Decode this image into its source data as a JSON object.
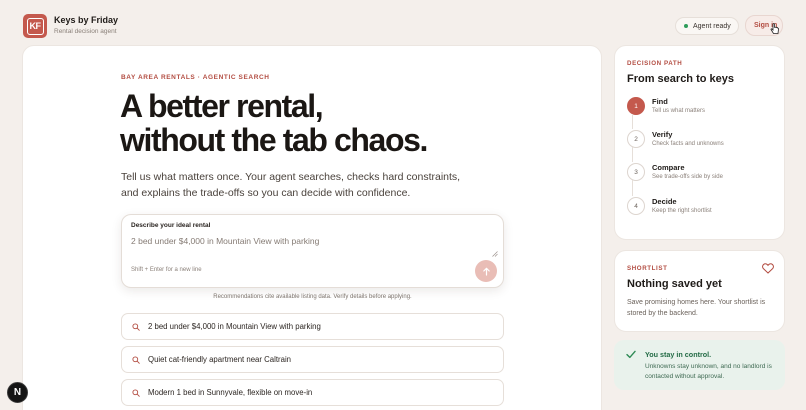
{
  "header": {
    "logo_text": "KF",
    "brand_name": "Keys by Friday",
    "brand_sub": "Rental decision agent",
    "status_label": "Agent ready",
    "signin_label": "Sign in"
  },
  "hero": {
    "eyebrow": "BAY AREA RENTALS · AGENTIC SEARCH",
    "title_line1": "A better rental,",
    "title_line2": "without the tab chaos.",
    "subtitle": "Tell us what matters once. Your agent searches, checks hard constraints, and explains the trade-offs so you can decide with confidence."
  },
  "prompt": {
    "label": "Describe your ideal rental",
    "placeholder": "2 bed under $4,000 in Mountain View with parking",
    "hint": "Shift + Enter for a new line",
    "note": "Recommendations cite available listing data. Verify details before applying."
  },
  "suggestions": [
    "2 bed under $4,000 in Mountain View with parking",
    "Quiet cat-friendly apartment near Caltrain",
    "Modern 1 bed in Sunnyvale, flexible on move-in"
  ],
  "decision_path": {
    "eyebrow": "DECISION PATH",
    "title": "From search to keys",
    "steps": [
      {
        "num": "1",
        "title": "Find",
        "desc": "Tell us what matters"
      },
      {
        "num": "2",
        "title": "Verify",
        "desc": "Check facts and unknowns"
      },
      {
        "num": "3",
        "title": "Compare",
        "desc": "See trade-offs side by side"
      },
      {
        "num": "4",
        "title": "Decide",
        "desc": "Keep the right shortlist"
      }
    ]
  },
  "shortlist": {
    "eyebrow": "SHORTLIST",
    "title": "Nothing saved yet",
    "text": "Save promising homes here. Your shortlist is stored by the backend."
  },
  "control": {
    "title": "You stay in control.",
    "text": "Unknowns stay unknown, and no landlord is contacted without approval."
  },
  "badge": "N",
  "colors": {
    "accent": "#c4594d",
    "background": "#f4efeb",
    "success": "#2e9d5a"
  }
}
